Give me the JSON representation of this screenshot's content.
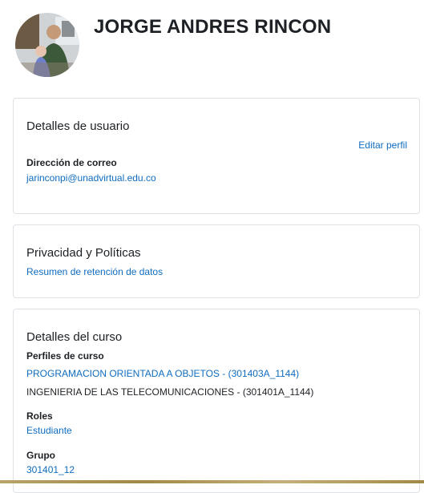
{
  "user": {
    "name": "JORGE ANDRES RINCON"
  },
  "user_details": {
    "title": "Detalles de usuario",
    "edit_label": "Editar perfil",
    "email_label": "Dirección de correo",
    "email": "jarinconpi@unadvirtual.edu.co"
  },
  "privacy": {
    "title": "Privacidad y Políticas",
    "retention_link": "Resumen de retención de datos"
  },
  "course": {
    "title": "Detalles del curso",
    "profiles_label": "Perfiles de curso",
    "profiles": [
      {
        "text": "PROGRAMACION ORIENTADA A OBJETOS - (301403A_1144)",
        "link": true
      },
      {
        "text": "INGENIERIA DE LAS TELECOMUNICACIONES - (301401A_1144)",
        "link": false
      }
    ],
    "roles_label": "Roles",
    "role": "Estudiante",
    "group_label": "Grupo",
    "group": "301401_12"
  },
  "colors": {
    "link": "#0f6cbf",
    "text": "#1d2125",
    "border": "#dee2e6"
  },
  "icons": {
    "avatar": "user-photo"
  }
}
